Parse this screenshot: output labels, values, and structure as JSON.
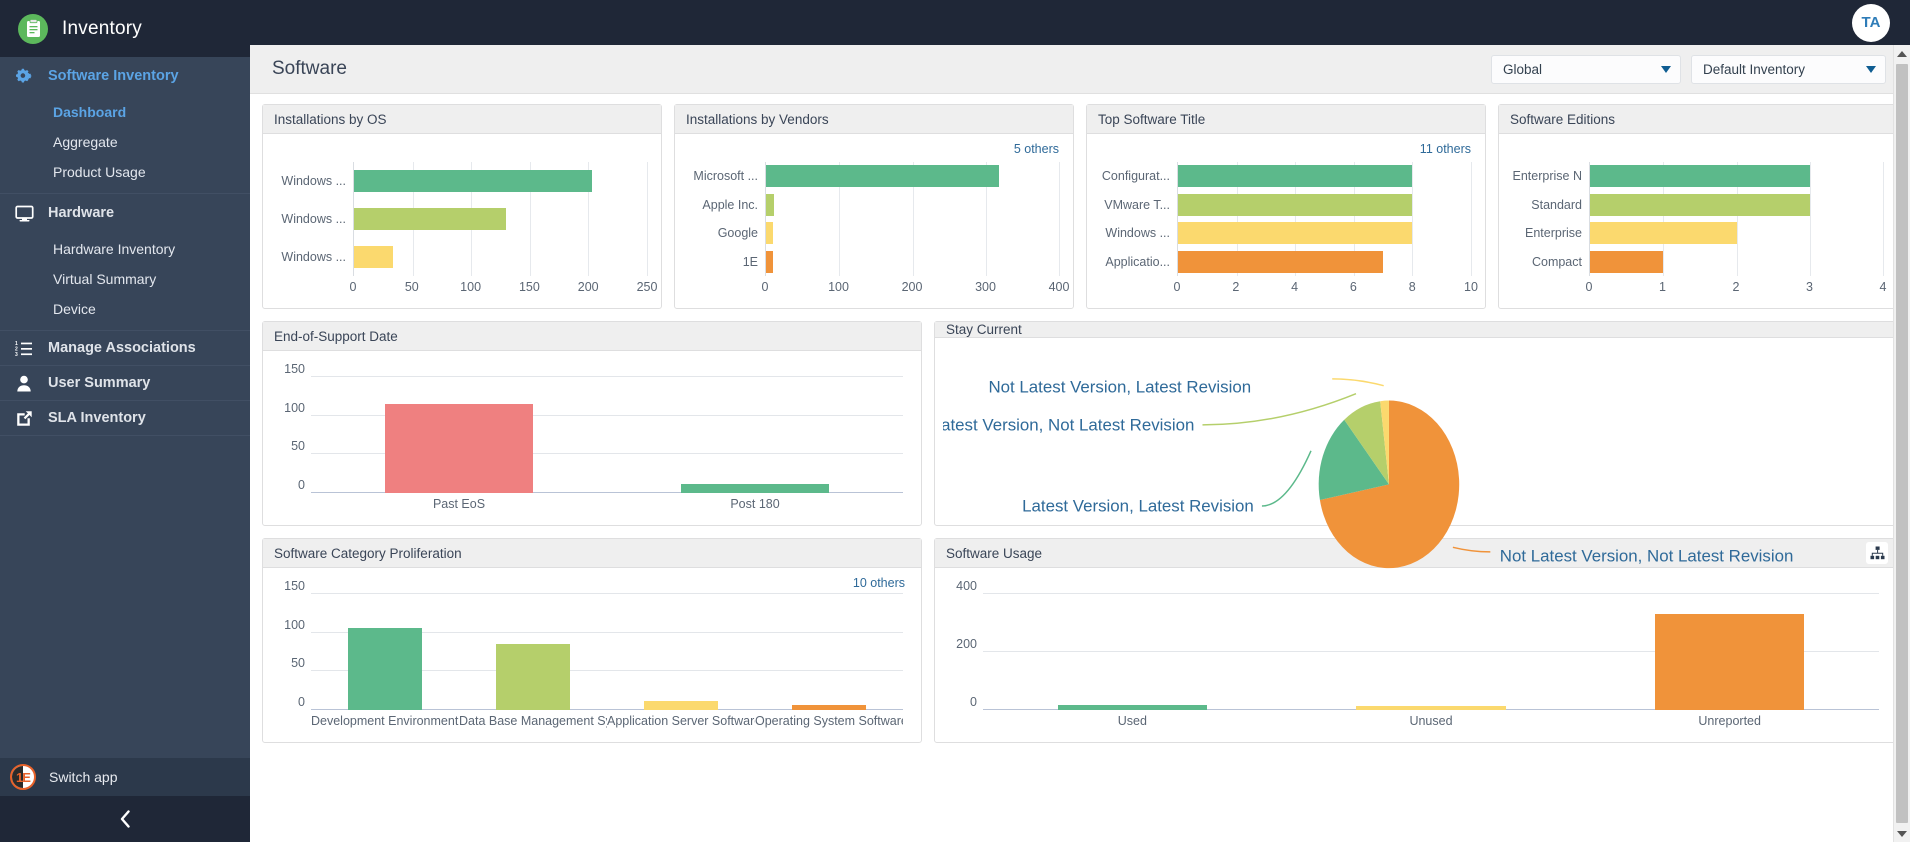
{
  "brand": {
    "title": "Inventory",
    "logo_icon": "clipboard-icon"
  },
  "topbar": {
    "avatar_initials": "TA"
  },
  "sidebar": {
    "groups": [
      {
        "parent": {
          "label": "Software Inventory",
          "icon": "gears-icon",
          "active": true
        },
        "children": [
          {
            "label": "Dashboard",
            "active": true
          },
          {
            "label": "Aggregate",
            "active": false
          },
          {
            "label": "Product Usage",
            "active": false
          }
        ]
      },
      {
        "parent": {
          "label": "Hardware",
          "icon": "monitor-icon",
          "active": false
        },
        "children": [
          {
            "label": "Hardware Inventory",
            "active": false
          },
          {
            "label": "Virtual Summary",
            "active": false
          },
          {
            "label": "Device",
            "active": false
          }
        ]
      },
      {
        "parent": {
          "label": "Manage Associations",
          "icon": "ordered-list-icon",
          "active": false
        },
        "children": []
      },
      {
        "parent": {
          "label": "User Summary",
          "icon": "user-icon",
          "active": false
        },
        "children": []
      },
      {
        "parent": {
          "label": "SLA Inventory",
          "icon": "external-link-icon",
          "active": false
        },
        "children": []
      }
    ],
    "switch_app": {
      "label": "Switch app",
      "logo_icon": "1e-logo-icon"
    },
    "collapse_icon": "chevron-left-icon"
  },
  "page": {
    "title": "Software",
    "selects": [
      {
        "name": "scope-select",
        "value": "Global",
        "icon": "chevron-down-icon"
      },
      {
        "name": "inventory-select",
        "value": "Default Inventory",
        "icon": "chevron-down-icon"
      }
    ]
  },
  "colors": {
    "green": "#5cb98b",
    "lightgreen": "#b5cf6b",
    "yellow": "#fbd96e",
    "orange": "#f0933a",
    "red": "#ef8080",
    "accent_blue": "#2f6a99",
    "sidebar_bg": "#374559",
    "header_bg": "#1f2737"
  },
  "panels": {
    "installations_by_os": {
      "title": "Installations by OS",
      "others": ""
    },
    "installations_by_vendors": {
      "title": "Installations by Vendors",
      "others": "5 others"
    },
    "top_software_title": {
      "title": "Top Software Title",
      "others": "11 others"
    },
    "software_editions": {
      "title": "Software Editions",
      "others": ""
    },
    "end_of_support_date": {
      "title": "End-of-Support Date",
      "others": ""
    },
    "stay_current": {
      "title": "Stay Current",
      "others": ""
    },
    "software_category_proliferation": {
      "title": "Software Category Proliferation",
      "others": "10 others"
    },
    "software_usage": {
      "title": "Software Usage",
      "others": "",
      "action_icon": "hierarchy-icon"
    }
  },
  "chart_data": [
    {
      "id": "installations_by_os",
      "type": "bar",
      "orientation": "horizontal",
      "title": "Installations by OS",
      "categories": [
        "Windows ...",
        "Windows ...",
        "Windows ..."
      ],
      "values": [
        203,
        130,
        33
      ],
      "colors": [
        "#5cb98b",
        "#b5cf6b",
        "#fbd96e"
      ],
      "xticks": [
        0,
        50,
        100,
        150,
        200,
        250
      ],
      "xlim": [
        0,
        250
      ],
      "xlabel": "",
      "ylabel": "",
      "grid": true,
      "legend": false
    },
    {
      "id": "installations_by_vendors",
      "type": "bar",
      "orientation": "horizontal",
      "title": "Installations by Vendors",
      "annotation": "5 others",
      "categories": [
        "Microsoft ...",
        "Apple Inc.",
        "Google",
        "1E"
      ],
      "values": [
        318,
        11,
        9,
        10
      ],
      "colors": [
        "#5cb98b",
        "#b5cf6b",
        "#fbd96e",
        "#f0933a"
      ],
      "xticks": [
        0,
        100,
        200,
        300,
        400
      ],
      "xlim": [
        0,
        400
      ],
      "xlabel": "",
      "ylabel": "",
      "grid": true,
      "legend": false
    },
    {
      "id": "top_software_title",
      "type": "bar",
      "orientation": "horizontal",
      "title": "Top Software Title",
      "annotation": "11 others",
      "categories": [
        "Configurat...",
        "VMware T...",
        "Windows ...",
        "Applicatio..."
      ],
      "values": [
        8,
        8,
        8,
        7
      ],
      "colors": [
        "#5cb98b",
        "#b5cf6b",
        "#fbd96e",
        "#f0933a"
      ],
      "xticks": [
        0,
        2,
        4,
        6,
        8,
        10
      ],
      "xlim": [
        0,
        10
      ],
      "xlabel": "",
      "ylabel": "",
      "grid": true,
      "legend": false
    },
    {
      "id": "software_editions",
      "type": "bar",
      "orientation": "horizontal",
      "title": "Software Editions",
      "categories": [
        "Enterprise N",
        "Standard",
        "Enterprise",
        "Compact"
      ],
      "values": [
        3,
        3,
        2,
        1
      ],
      "colors": [
        "#5cb98b",
        "#b5cf6b",
        "#fbd96e",
        "#f0933a"
      ],
      "xticks": [
        0,
        1,
        2,
        3,
        4
      ],
      "xlim": [
        0,
        4
      ],
      "xlabel": "",
      "ylabel": "",
      "grid": true,
      "legend": false
    },
    {
      "id": "end_of_support_date",
      "type": "bar",
      "orientation": "vertical",
      "title": "End-of-Support Date",
      "categories": [
        "Past EoS",
        "Post 180"
      ],
      "values": [
        115,
        12
      ],
      "colors": [
        "#ef8080",
        "#5cb98b"
      ],
      "yticks": [
        0,
        50,
        100,
        150
      ],
      "ylim": [
        0,
        150
      ],
      "xlabel": "",
      "ylabel": "",
      "grid": true,
      "legend": false
    },
    {
      "id": "stay_current",
      "type": "pie",
      "title": "Stay Current",
      "labels": [
        "Not Latest Version, Not Latest Revision",
        "Latest Version, Latest Revision",
        "Latest Version, Not Latest Revision",
        "Not Latest Version, Latest Revision"
      ],
      "values": [
        72,
        17,
        9,
        2
      ],
      "colors": [
        "#f0933a",
        "#5cb98b",
        "#b5cf6b",
        "#fbd96e"
      ],
      "legend": "callout-labels"
    },
    {
      "id": "software_category_proliferation",
      "type": "bar",
      "orientation": "vertical",
      "title": "Software Category Proliferation",
      "annotation": "10 others",
      "categories": [
        "Development Environment ...",
        "Data Base Management Sys...",
        "Application Server Software",
        "Operating System Software"
      ],
      "values": [
        106,
        85,
        12,
        7
      ],
      "colors": [
        "#5cb98b",
        "#b5cf6b",
        "#fbd96e",
        "#f0933a"
      ],
      "yticks": [
        0,
        50,
        100,
        150
      ],
      "ylim": [
        0,
        150
      ],
      "xlabel": "",
      "ylabel": "",
      "grid": true,
      "legend": false
    },
    {
      "id": "software_usage",
      "type": "bar",
      "orientation": "vertical",
      "title": "Software Usage",
      "categories": [
        "Used",
        "Unused",
        "Unreported"
      ],
      "values": [
        18,
        15,
        330
      ],
      "colors": [
        "#5cb98b",
        "#fbd96e",
        "#f0933a"
      ],
      "yticks": [
        0,
        200,
        400
      ],
      "ylim": [
        0,
        400
      ],
      "xlabel": "",
      "ylabel": "",
      "grid": true,
      "legend": false
    }
  ]
}
